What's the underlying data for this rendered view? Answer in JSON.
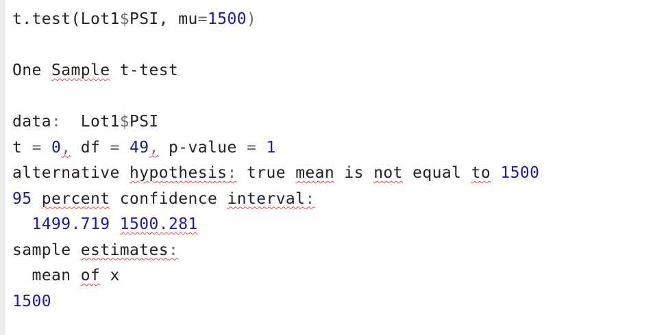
{
  "command": {
    "fn": "t.test(",
    "arg": "Lot1",
    "dollar": "$",
    "field": "PSI",
    "comma": ", mu",
    "eq": "=",
    "mu": "1500",
    "close": ")"
  },
  "title": {
    "w1": "One ",
    "w2": "Sample",
    "w3": " t-test"
  },
  "data_line": {
    "label": "data",
    "colon": ":",
    "gap": "  Lot1",
    "dollar": "$",
    "field": "PSI"
  },
  "stats_line": {
    "t_label": "t ",
    "eq1": "=",
    "t_val": " 0",
    "c1": ",",
    "df_label": " df ",
    "eq2": "=",
    "df_val": " 49",
    "c2": ",",
    "p_label": " p-value ",
    "eq3": "=",
    "p_val": " 1"
  },
  "alt_line": {
    "w1": "alternative ",
    "w2": "hypothesis",
    "colon": ":",
    "w3": " true ",
    "w4": "mean",
    "w5": " is ",
    "w6": "not",
    "w7": " equal ",
    "w8": "to",
    "val": " 1500"
  },
  "ci_line": {
    "pct": "95",
    "w1": " ",
    "w2": "percent",
    "w3": " confidence ",
    "w4": "interval",
    "colon": ":"
  },
  "ci_values": {
    "indent": "  ",
    "lower": "1499.719",
    "sep": " ",
    "upper": "1500.281"
  },
  "est_line": {
    "w1": "sample ",
    "w2": "estimates",
    "colon": ":"
  },
  "est_name": {
    "indent": "  mean ",
    "w2": "of",
    "w3": " x"
  },
  "est_value": "1500"
}
